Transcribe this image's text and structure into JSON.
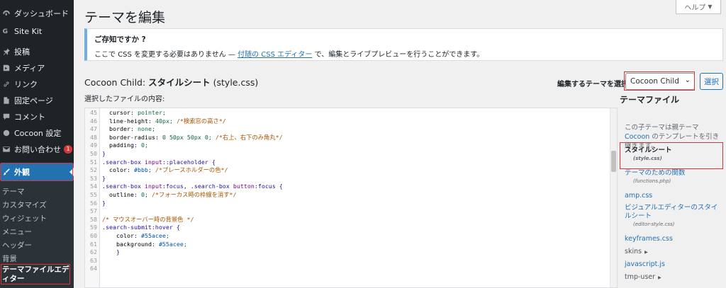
{
  "sidebar": {
    "items": [
      {
        "label": "ダッシュボード",
        "icon": "dashboard-icon"
      },
      {
        "label": "Site Kit",
        "icon": "site-kit-icon"
      },
      {
        "label": "投稿",
        "icon": "pin-icon"
      },
      {
        "label": "メディア",
        "icon": "media-icon"
      },
      {
        "label": "リンク",
        "icon": "link-icon"
      },
      {
        "label": "固定ページ",
        "icon": "page-icon"
      },
      {
        "label": "コメント",
        "icon": "comment-icon"
      },
      {
        "label": "Cocoon 設定",
        "icon": "cocoon-icon"
      },
      {
        "label": "お問い合わせ",
        "icon": "mail-icon",
        "badge": "1"
      },
      {
        "label": "外観",
        "icon": "brush-icon"
      }
    ],
    "submenu": [
      "テーマ",
      "カスタマイズ",
      "ウィジェット",
      "メニュー",
      "ヘッダー",
      "背景",
      "テーマファイルエディター"
    ]
  },
  "header": {
    "title": "テーマを編集",
    "help": "ヘルプ"
  },
  "notice": {
    "title": "ご存知ですか ?",
    "text_before": "ここで CSS を変更する必要はありません — ",
    "link": "付随の CSS エディター",
    "text_after": " で、編集とライブプレビューを行うことができます。"
  },
  "editor_header": {
    "theme_name": "Cocoon Child: ",
    "file_title": "スタイルシート",
    "file_name": " (style.css)",
    "content_label": "選択したファイルの内容:",
    "select_label": "編集するテーマを選択:",
    "selected_theme": "Cocoon Child",
    "select_button": "選択"
  },
  "code": [
    {
      "n": "45",
      "t": "  cursor: pointer;"
    },
    {
      "n": "46",
      "t": "  line-height: 40px; /*検索窓の高さ*/"
    },
    {
      "n": "47",
      "t": "  border: none;"
    },
    {
      "n": "48",
      "t": "  border-radius: 0 50px 50px 0; /*右上、右下のみ角丸*/"
    },
    {
      "n": "49",
      "t": "  padding: 0;"
    },
    {
      "n": "50",
      "t": "}"
    },
    {
      "n": "51",
      "t": ".search-box input::placeholder {"
    },
    {
      "n": "52",
      "t": "  color: #bbb; /*プレースホルダーの色*/"
    },
    {
      "n": "53",
      "t": "}"
    },
    {
      "n": "54",
      "t": ".search-box input:focus, .search-box button:focus {"
    },
    {
      "n": "55",
      "t": "  outline: 0; /*フォーカス時の枠線を消す*/"
    },
    {
      "n": "56",
      "t": "}"
    },
    {
      "n": "57",
      "t": ""
    },
    {
      "n": "58",
      "t": "/* マウスオーバー時の背景色 */"
    },
    {
      "n": "59",
      "t": ".search-submit:hover {"
    },
    {
      "n": "60",
      "t": "    color: #55acee;"
    },
    {
      "n": "61",
      "t": "    background: #55acee;"
    },
    {
      "n": "62",
      "t": "    }"
    },
    {
      "n": "63",
      "t": ""
    },
    {
      "n": "64",
      "t": ""
    }
  ],
  "files_panel": {
    "title": "テーマファイル",
    "desc_before": "この子テーマは親テーマ ",
    "desc_link": "Cocoon",
    "desc_after": " のテンプレートを引き継ぎます。",
    "files": [
      {
        "label": "スタイルシート",
        "filename": "(style.css)",
        "active": true
      },
      {
        "label": "テーマのための関数",
        "filename": "(functions.php)"
      },
      {
        "label": "amp.css"
      },
      {
        "label": "ビジュアルエディターのスタイルシート",
        "filename": "(editor-style.css)"
      },
      {
        "label": "keyframes.css"
      },
      {
        "label": "skins",
        "folder": true
      },
      {
        "label": "javascript.js"
      },
      {
        "label": "tmp-user",
        "folder": true
      }
    ]
  },
  "colors": {
    "sidebar_bg": "#1d2327",
    "accent": "#2271b1",
    "highlight_box": "#d63638",
    "notice_border": "#72aee6"
  }
}
